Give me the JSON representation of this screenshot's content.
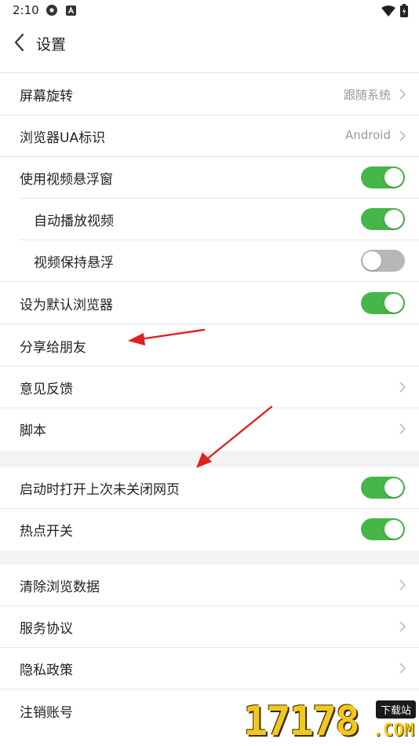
{
  "status": {
    "time": "2:10"
  },
  "header": {
    "title": "设置"
  },
  "rows": [
    {
      "label": "屏幕旋转",
      "value": "跟随系统"
    },
    {
      "label": "浏览器UA标识",
      "value": "Android"
    },
    {
      "label": "使用视频悬浮窗",
      "toggle": "on"
    },
    {
      "label": "自动播放视频",
      "toggle": "on"
    },
    {
      "label": "视频保持悬浮",
      "toggle": "off"
    },
    {
      "label": "设为默认浏览器",
      "toggle": "on"
    },
    {
      "label": "分享给朋友"
    },
    {
      "label": "意见反馈"
    },
    {
      "label": "脚本"
    },
    {
      "label": "启动时打开上次未关闭网页",
      "toggle": "on"
    },
    {
      "label": "热点开关",
      "toggle": "on"
    },
    {
      "label": "清除浏览数据"
    },
    {
      "label": "服务协议"
    },
    {
      "label": "隐私政策"
    },
    {
      "label": "注销账号"
    }
  ],
  "watermark": {
    "number": "17178",
    "badge": "下载站",
    "suffix": ".COM"
  },
  "colors": {
    "toggle_on": "#46b64a",
    "toggle_off": "#b7b7b7",
    "annotation_arrow": "#e02020"
  }
}
